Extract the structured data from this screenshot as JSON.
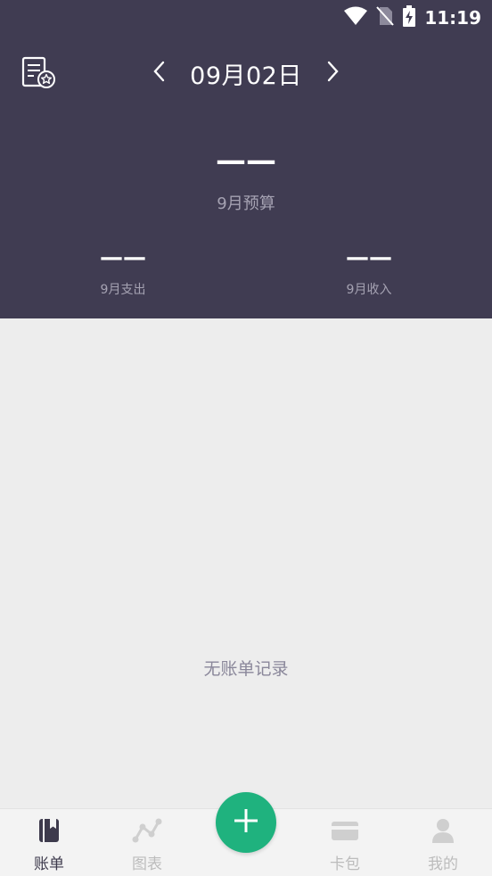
{
  "status_bar": {
    "time": "11:19"
  },
  "header": {
    "date": "09月02日",
    "budget_value": "——",
    "budget_label": "9月预算",
    "expense_value": "——",
    "expense_label": "9月支出",
    "income_value": "——",
    "income_label": "9月收入"
  },
  "main": {
    "empty_text": "无账单记录"
  },
  "tabbar": {
    "items": [
      {
        "label": "账单",
        "icon": "book-icon",
        "active": true
      },
      {
        "label": "图表",
        "icon": "chart-icon",
        "active": false
      },
      {
        "label": "卡包",
        "icon": "card-icon",
        "active": false
      },
      {
        "label": "我的",
        "icon": "user-icon",
        "active": false
      }
    ]
  },
  "colors": {
    "header_bg": "#403c52",
    "accent": "#1fb27e",
    "body_bg": "#ededed"
  }
}
